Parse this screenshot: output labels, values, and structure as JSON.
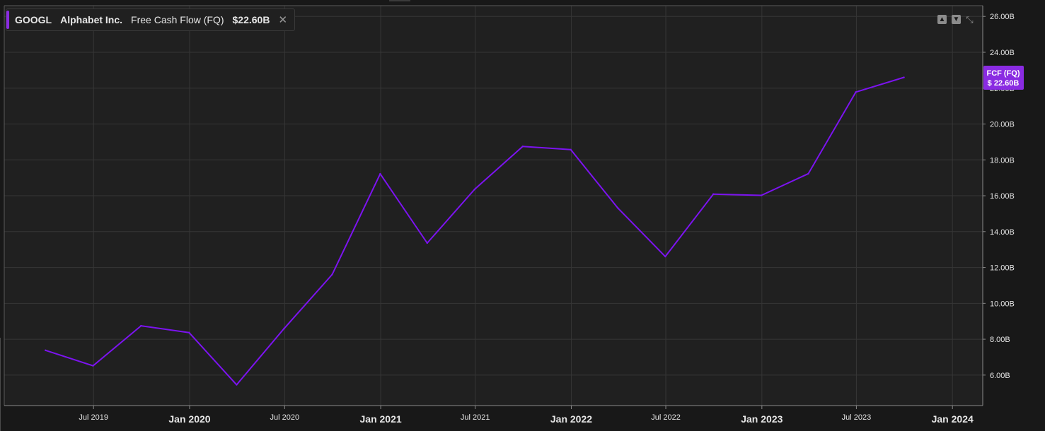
{
  "legend": {
    "symbol": "GOOGL",
    "company": "Alphabet Inc.",
    "metric": "Free Cash Flow (FQ)",
    "value": "$22.60B",
    "close_icon": "close-icon"
  },
  "controls": [
    "move-up-icon",
    "move-down-icon",
    "collapse-icon"
  ],
  "price_tag": {
    "label": "FCF (FQ)",
    "value": "$ 22.60B"
  },
  "colors": {
    "background": "#181818",
    "plot_background": "#202020",
    "grid": "#363636",
    "line": "#7c13f0",
    "tag": "#8a2be2",
    "text": "#e6e6e6"
  },
  "chart_data": {
    "type": "line",
    "title": "",
    "xlabel": "",
    "ylabel": "",
    "x_ticks": [
      {
        "label": "Jul 2019",
        "date": "2019-07-01",
        "major": false
      },
      {
        "label": "Jan 2020",
        "date": "2020-01-01",
        "major": true
      },
      {
        "label": "Jul 2020",
        "date": "2020-07-01",
        "major": false
      },
      {
        "label": "Jan 2021",
        "date": "2021-01-01",
        "major": true
      },
      {
        "label": "Jul 2021",
        "date": "2021-07-01",
        "major": false
      },
      {
        "label": "Jan 2022",
        "date": "2022-01-01",
        "major": true
      },
      {
        "label": "Jul 2022",
        "date": "2022-07-01",
        "major": false
      },
      {
        "label": "Jan 2023",
        "date": "2023-01-01",
        "major": true
      },
      {
        "label": "Jul 2023",
        "date": "2023-07-01",
        "major": false
      },
      {
        "label": "Jan 2024",
        "date": "2024-01-01",
        "major": true
      }
    ],
    "y_ticks": [
      {
        "label": "6.00B",
        "value": 6
      },
      {
        "label": "8.00B",
        "value": 8
      },
      {
        "label": "10.00B",
        "value": 10
      },
      {
        "label": "12.00B",
        "value": 12
      },
      {
        "label": "14.00B",
        "value": 14
      },
      {
        "label": "16.00B",
        "value": 16
      },
      {
        "label": "18.00B",
        "value": 18
      },
      {
        "label": "20.00B",
        "value": 20
      },
      {
        "label": "22.00B",
        "value": 22
      },
      {
        "label": "24.00B",
        "value": 24
      },
      {
        "label": "26.00B",
        "value": 26
      }
    ],
    "ylim": [
      4.3,
      26.6
    ],
    "xlim": [
      "2019-01-11",
      "2024-02-28"
    ],
    "unit": "B",
    "grid": true,
    "legend_position": "top-left",
    "series": [
      {
        "name": "Free Cash Flow (FQ)",
        "points": [
          {
            "x": "2019-03-31",
            "y": 7.38
          },
          {
            "x": "2019-06-30",
            "y": 6.52
          },
          {
            "x": "2019-09-30",
            "y": 8.75
          },
          {
            "x": "2019-12-31",
            "y": 8.37
          },
          {
            "x": "2020-03-31",
            "y": 5.46
          },
          {
            "x": "2020-06-30",
            "y": 8.6
          },
          {
            "x": "2020-09-30",
            "y": 11.61
          },
          {
            "x": "2020-12-31",
            "y": 17.22
          },
          {
            "x": "2021-03-31",
            "y": 13.36
          },
          {
            "x": "2021-06-30",
            "y": 16.36
          },
          {
            "x": "2021-09-30",
            "y": 18.75
          },
          {
            "x": "2021-12-31",
            "y": 18.57
          },
          {
            "x": "2022-03-31",
            "y": 15.32
          },
          {
            "x": "2022-06-30",
            "y": 12.61
          },
          {
            "x": "2022-09-30",
            "y": 16.09
          },
          {
            "x": "2022-12-31",
            "y": 16.02
          },
          {
            "x": "2023-03-31",
            "y": 17.23
          },
          {
            "x": "2023-06-30",
            "y": 21.78
          },
          {
            "x": "2023-09-30",
            "y": 22.6
          }
        ]
      }
    ]
  }
}
